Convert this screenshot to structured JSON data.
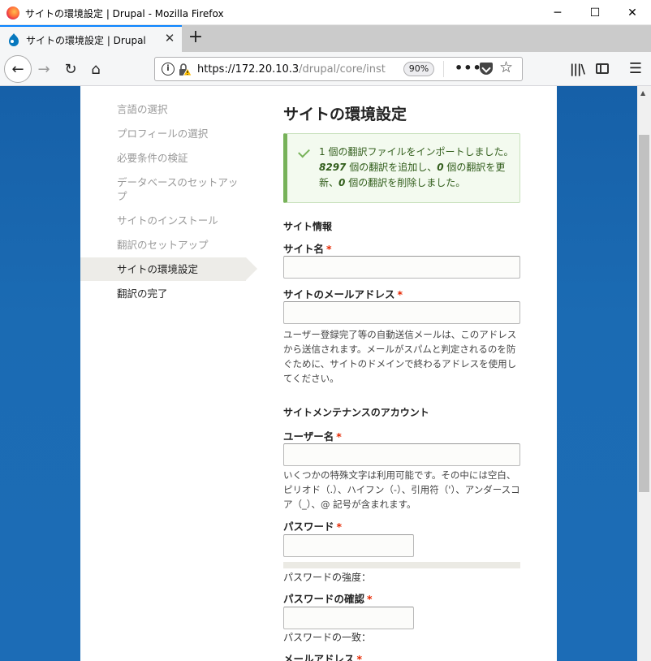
{
  "window": {
    "title": "サイトの環境設定 | Drupal - Mozilla Firefox",
    "min_glyph": "─",
    "max_glyph": "☐",
    "close_glyph": "✕"
  },
  "tabs": [
    {
      "title": "サイトの環境設定 | Drupal",
      "close_glyph": "✕"
    }
  ],
  "newtab_glyph": "+",
  "nav": {
    "back_glyph": "←",
    "forward_glyph": "→",
    "reload_glyph": "↻",
    "home_glyph": "⌂",
    "url_host": "https://172.20.10.3",
    "url_path": "/drupal/core/inst",
    "zoom": "90%",
    "info_glyph": "i",
    "more_glyph": "•••",
    "star_glyph": "☆",
    "library_glyph": "|||\\",
    "menu_glyph": "☰"
  },
  "install_steps": [
    {
      "label": "言語の選択",
      "state": "done"
    },
    {
      "label": "プロフィールの選択",
      "state": "done"
    },
    {
      "label": "必要条件の検証",
      "state": "done"
    },
    {
      "label": "データベースのセットアップ",
      "state": "done"
    },
    {
      "label": "サイトのインストール",
      "state": "done"
    },
    {
      "label": "翻訳のセットアップ",
      "state": "done"
    },
    {
      "label": "サイトの環境設定",
      "state": "active"
    },
    {
      "label": "翻訳の完了",
      "state": "todo"
    }
  ],
  "page": {
    "title": "サイトの環境設定",
    "status": {
      "part1": "1 個の翻訳ファイルをインポートしました。",
      "added": "8297",
      "part2": " 個の翻訳を追加し、",
      "updated": "0",
      "part3": " 個の翻訳を更新、",
      "deleted": "0",
      "part4": " 個の翻訳を削除しました。"
    },
    "site_info": {
      "heading": "サイト情報",
      "site_name_label": "サイト名",
      "site_mail_label": "サイトのメールアドレス",
      "site_mail_desc": "ユーザー登録完了等の自動送信メールは、このアドレスから送信されます。メールがスパムと判定されるのを防ぐために、サイトのドメインで終わるアドレスを使用してください。"
    },
    "account": {
      "heading": "サイトメンテナンスのアカウント",
      "username_label": "ユーザー名",
      "username_desc": "いくつかの特殊文字は利用可能です。その中には空白、ピリオド（.）、ハイフン（-）、引用符（'）、アンダースコア（_）、@ 記号が含まれます。",
      "password_label": "パスワード",
      "strength_label": "パスワードの強度：",
      "confirm_label": "パスワードの確認",
      "match_label": "パスワードの一致：",
      "email_label": "メールアドレス"
    },
    "required_mark": "*"
  }
}
